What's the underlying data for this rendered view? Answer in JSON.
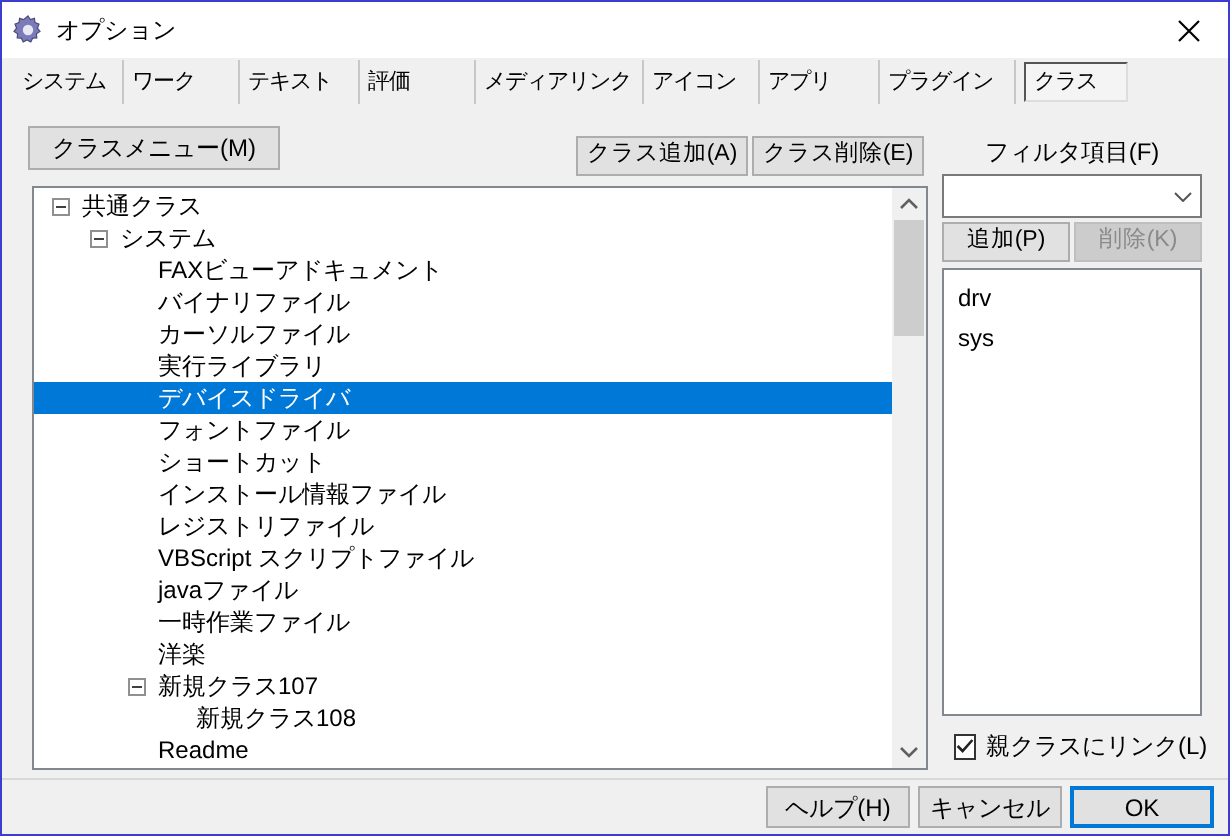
{
  "window": {
    "title": "オプション"
  },
  "tabs": [
    {
      "label": "システム",
      "selected": false
    },
    {
      "label": "ワーク",
      "selected": false
    },
    {
      "label": "テキスト",
      "selected": false
    },
    {
      "label": "評価",
      "selected": false
    },
    {
      "label": "メディアリンク",
      "selected": false
    },
    {
      "label": "アイコン",
      "selected": false
    },
    {
      "label": "アプリ",
      "selected": false
    },
    {
      "label": "プラグイン",
      "selected": false
    },
    {
      "label": "クラス",
      "selected": true
    }
  ],
  "class_menu_button": "クラスメニュー(M)",
  "add_class_button": "クラス追加(A)",
  "delete_class_button": "クラス削除(E)",
  "tree": [
    {
      "label": "共通クラス",
      "selected": false,
      "expanded": true,
      "children": [
        {
          "label": "システム",
          "selected": false,
          "expanded": true,
          "children": [
            {
              "label": "FAXビューアドキュメント",
              "selected": false
            },
            {
              "label": "バイナリファイル",
              "selected": false
            },
            {
              "label": "カーソルファイル",
              "selected": false
            },
            {
              "label": "実行ライブラリ",
              "selected": false
            },
            {
              "label": "デバイスドライバ",
              "selected": true
            },
            {
              "label": "フォントファイル",
              "selected": false
            },
            {
              "label": "ショートカット",
              "selected": false
            },
            {
              "label": "インストール情報ファイル",
              "selected": false
            },
            {
              "label": "レジストリファイル",
              "selected": false
            },
            {
              "label": "VBScript スクリプトファイル",
              "selected": false
            },
            {
              "label": "javaファイル",
              "selected": false
            },
            {
              "label": "一時作業ファイル",
              "selected": false
            },
            {
              "label": "洋楽",
              "selected": false
            },
            {
              "label": "新規クラス107",
              "selected": false,
              "expanded": true,
              "children": [
                {
                  "label": "新規クラス108",
                  "selected": false
                }
              ]
            },
            {
              "label": "Readme",
              "selected": false
            }
          ]
        }
      ]
    }
  ],
  "filter": {
    "label": "フィルタ項目(F)",
    "add_button": {
      "label": "追加(P)",
      "disabled": false
    },
    "delete_button": {
      "label": "削除(K)",
      "disabled": true
    },
    "items": [
      "drv",
      "sys"
    ],
    "link_parent": {
      "label": "親クラスにリンク(L)",
      "checked": true
    }
  },
  "buttons": [
    {
      "label": "ヘルプ(H)",
      "default": false
    },
    {
      "label": "キャンセル",
      "default": false
    },
    {
      "label": "OK",
      "default": true
    }
  ]
}
